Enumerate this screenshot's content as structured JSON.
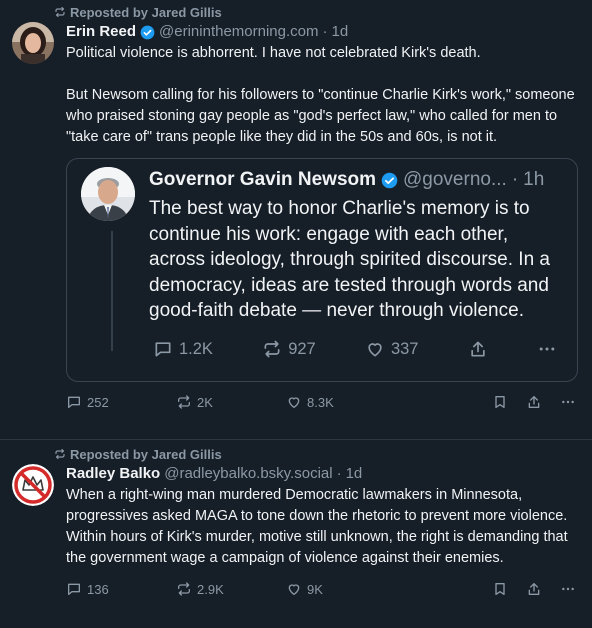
{
  "posts": [
    {
      "repost_label": "Reposted by Jared Gillis",
      "author": {
        "name": "Erin Reed",
        "handle": "@erininthemorning.com",
        "time": "1d",
        "verified": true
      },
      "text": "Political violence is abhorrent. I have not celebrated Kirk's death.\n\nBut Newsom calling for his followers to \"continue Charlie Kirk's work,\" someone who praised stoning gay people as \"god's perfect law,\" who called for men to \"take care of\" trans people like they did in the 50s and 60s, is not it.",
      "quote": {
        "author": {
          "name": "Governor Gavin Newsom",
          "handle": "@governo...",
          "time": "1h",
          "verified": true
        },
        "text": "The best way to honor Charlie's memory is to continue his work: engage with each other, across ideology, through spirited discourse. In a democracy, ideas are tested through words and good-faith debate — never through violence.",
        "counts": {
          "replies": "1.2K",
          "reposts": "927",
          "likes": "337"
        }
      },
      "counts": {
        "replies": "252",
        "reposts": "2K",
        "likes": "8.3K"
      }
    },
    {
      "repost_label": "Reposted by Jared Gillis",
      "author": {
        "name": "Radley Balko",
        "handle": "@radleybalko.bsky.social",
        "time": "1d",
        "verified": false
      },
      "text": "When a right-wing man murdered Democratic lawmakers in Minnesota, progressives asked MAGA to tone down the rhetoric to prevent more violence. Within hours of Kirk's murder, motive still unknown, the right is demanding that the government wage a campaign of violence against their enemies.",
      "counts": {
        "replies": "136",
        "reposts": "2.9K",
        "likes": "9K"
      }
    }
  ],
  "colors": {
    "background": "#161e27",
    "text": "#f1f3f5",
    "muted": "#8b98a5",
    "verified": "#1d9bf0",
    "border": "#3a4552"
  },
  "icons": [
    "repost-icon",
    "verified-badge-icon",
    "reply-icon",
    "like-icon",
    "share-icon",
    "more-icon",
    "bookmark-icon"
  ]
}
